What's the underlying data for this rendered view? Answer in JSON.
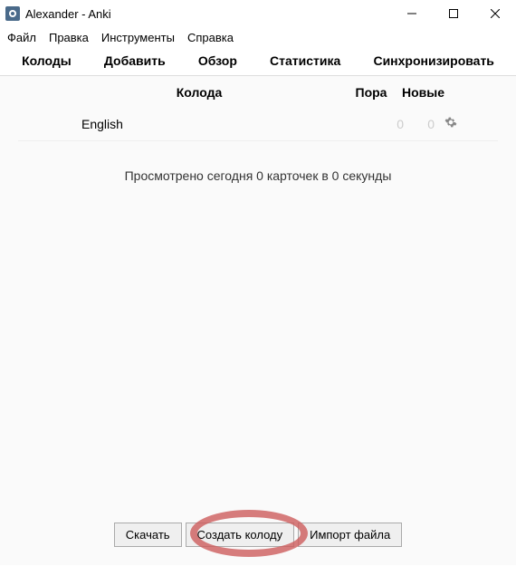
{
  "titlebar": {
    "title": "Alexander - Anki"
  },
  "menubar": {
    "file": "Файл",
    "edit": "Правка",
    "tools": "Инструменты",
    "help": "Справка"
  },
  "tabs": {
    "decks": "Колоды",
    "add": "Добавить",
    "browse": "Обзор",
    "stats": "Статистика",
    "sync": "Синхронизировать"
  },
  "deck_header": {
    "deck": "Колода",
    "due": "Пора",
    "new": "Новые"
  },
  "decks": [
    {
      "name": "English",
      "due": "0",
      "new": "0"
    }
  ],
  "status": "Просмотрено сегодня 0 карточек в 0 секунды",
  "buttons": {
    "download": "Скачать",
    "create": "Создать колоду",
    "import": "Импорт файла"
  }
}
